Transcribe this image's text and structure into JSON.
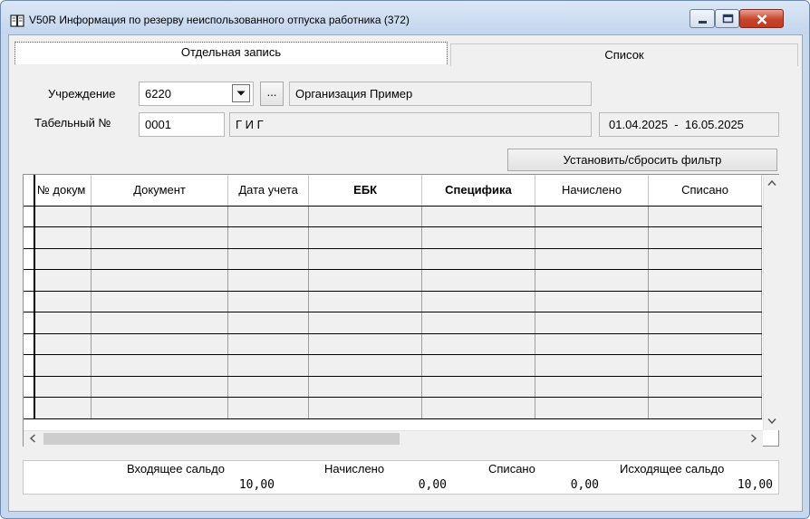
{
  "window": {
    "title": "V50R Информация по резерву неиспользованного отпуска работника (372)"
  },
  "tabs": [
    {
      "label": "Отдельная запись"
    },
    {
      "label": "Список"
    }
  ],
  "form": {
    "org_label": "Учреждение",
    "org_code": "6220",
    "org_browse_label": "...",
    "org_name": "Организация Пример",
    "tab_no_label": "Табельный №",
    "tab_no": "0001",
    "employee_name": "Г И Г",
    "period": "01.04.2025  -  16.05.2025",
    "filter_button_label": "Установить/сбросить фильтр"
  },
  "grid": {
    "columns": [
      "№ докум",
      "Документ",
      "Дата учета",
      "ЕБК",
      "Специфика",
      "Начислено",
      "Списано"
    ],
    "bold_columns": [
      "ЕБК",
      "Специфика"
    ],
    "rows": [
      [],
      [],
      [],
      [],
      [],
      [],
      [],
      [],
      [],
      []
    ]
  },
  "totals": {
    "labels": [
      "Входящее сальдо",
      "Начислено",
      "Списано",
      "Исходящее сальдо"
    ],
    "values": [
      "10,00",
      "0,00",
      "0,00",
      "10,00"
    ]
  },
  "icons": {
    "app": "book-icon",
    "minimize": "minimize-icon",
    "maximize": "maximize-icon",
    "close": "close-icon",
    "dropdown": "dropdown-arrow-icon",
    "scroll_up": "chevron-up-icon",
    "scroll_down": "chevron-down-icon",
    "scroll_left": "chevron-left-icon",
    "scroll_right": "chevron-right-icon"
  },
  "colors": {
    "close_button": "#c8432b",
    "titlebar": "#c3d6ee"
  }
}
